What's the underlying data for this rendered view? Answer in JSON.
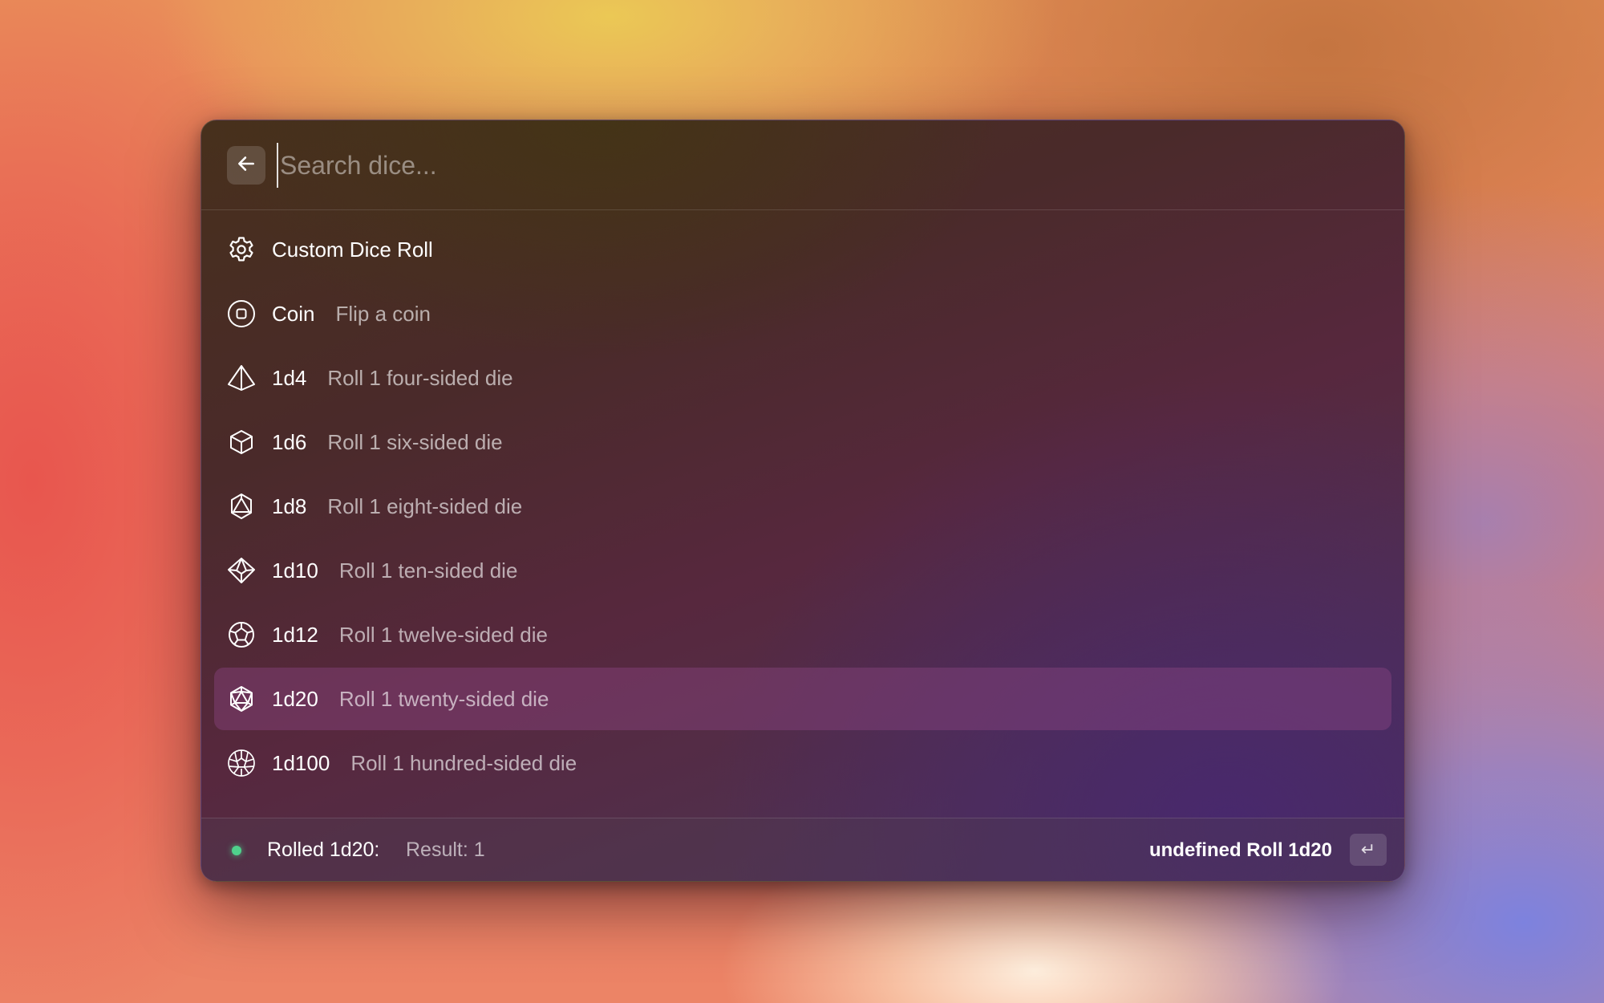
{
  "search": {
    "placeholder": "Search dice...",
    "value": ""
  },
  "items": [
    {
      "icon": "gear-icon",
      "title": "Custom Dice Roll",
      "subtitle": ""
    },
    {
      "icon": "coin-icon",
      "title": "Coin",
      "subtitle": "Flip a coin"
    },
    {
      "icon": "d4-icon",
      "title": "1d4",
      "subtitle": "Roll 1 four-sided die"
    },
    {
      "icon": "d6-icon",
      "title": "1d6",
      "subtitle": "Roll 1 six-sided die"
    },
    {
      "icon": "d8-icon",
      "title": "1d8",
      "subtitle": "Roll 1 eight-sided die"
    },
    {
      "icon": "d10-icon",
      "title": "1d10",
      "subtitle": "Roll 1 ten-sided die"
    },
    {
      "icon": "d12-icon",
      "title": "1d12",
      "subtitle": "Roll 1 twelve-sided die"
    },
    {
      "icon": "d20-icon",
      "title": "1d20",
      "subtitle": "Roll 1 twenty-sided die",
      "selected": true
    },
    {
      "icon": "d100-icon",
      "title": "1d100",
      "subtitle": "Roll 1 hundred-sided die"
    }
  ],
  "footer": {
    "status_label": "Rolled 1d20:",
    "status_result": "Result: 1",
    "status_color": "#4fd18c",
    "action_label": "undefined Roll 1d20",
    "enter_key_symbol": "↵"
  },
  "colors": {
    "selected_row": "#7a3c6e",
    "accent_green": "#4fd18c"
  }
}
